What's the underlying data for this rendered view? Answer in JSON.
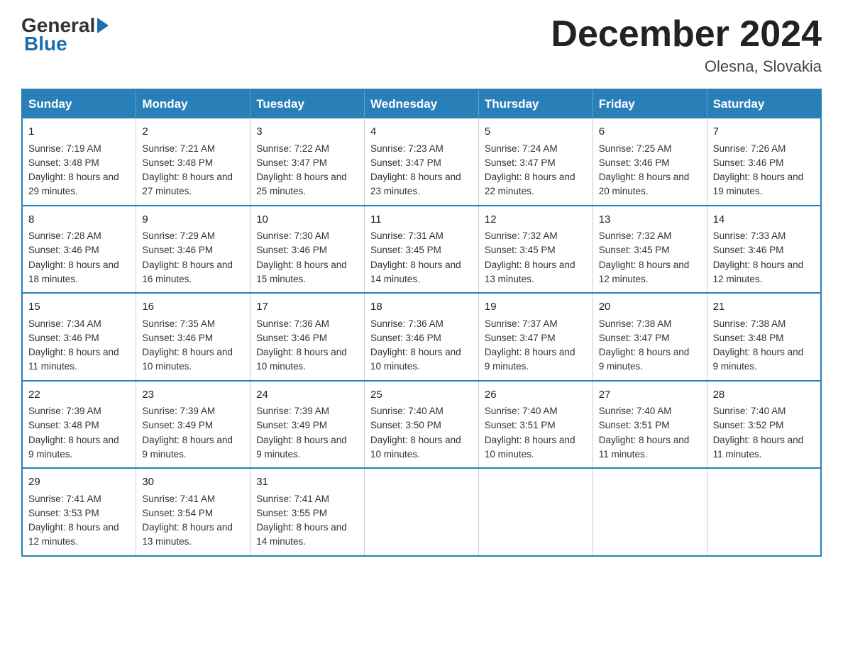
{
  "header": {
    "month_title": "December 2024",
    "location": "Olesna, Slovakia"
  },
  "days_of_week": [
    "Sunday",
    "Monday",
    "Tuesday",
    "Wednesday",
    "Thursday",
    "Friday",
    "Saturday"
  ],
  "weeks": [
    [
      {
        "day": "1",
        "sunrise": "7:19 AM",
        "sunset": "3:48 PM",
        "daylight": "8 hours and 29 minutes."
      },
      {
        "day": "2",
        "sunrise": "7:21 AM",
        "sunset": "3:48 PM",
        "daylight": "8 hours and 27 minutes."
      },
      {
        "day": "3",
        "sunrise": "7:22 AM",
        "sunset": "3:47 PM",
        "daylight": "8 hours and 25 minutes."
      },
      {
        "day": "4",
        "sunrise": "7:23 AM",
        "sunset": "3:47 PM",
        "daylight": "8 hours and 23 minutes."
      },
      {
        "day": "5",
        "sunrise": "7:24 AM",
        "sunset": "3:47 PM",
        "daylight": "8 hours and 22 minutes."
      },
      {
        "day": "6",
        "sunrise": "7:25 AM",
        "sunset": "3:46 PM",
        "daylight": "8 hours and 20 minutes."
      },
      {
        "day": "7",
        "sunrise": "7:26 AM",
        "sunset": "3:46 PM",
        "daylight": "8 hours and 19 minutes."
      }
    ],
    [
      {
        "day": "8",
        "sunrise": "7:28 AM",
        "sunset": "3:46 PM",
        "daylight": "8 hours and 18 minutes."
      },
      {
        "day": "9",
        "sunrise": "7:29 AM",
        "sunset": "3:46 PM",
        "daylight": "8 hours and 16 minutes."
      },
      {
        "day": "10",
        "sunrise": "7:30 AM",
        "sunset": "3:46 PM",
        "daylight": "8 hours and 15 minutes."
      },
      {
        "day": "11",
        "sunrise": "7:31 AM",
        "sunset": "3:45 PM",
        "daylight": "8 hours and 14 minutes."
      },
      {
        "day": "12",
        "sunrise": "7:32 AM",
        "sunset": "3:45 PM",
        "daylight": "8 hours and 13 minutes."
      },
      {
        "day": "13",
        "sunrise": "7:32 AM",
        "sunset": "3:45 PM",
        "daylight": "8 hours and 12 minutes."
      },
      {
        "day": "14",
        "sunrise": "7:33 AM",
        "sunset": "3:46 PM",
        "daylight": "8 hours and 12 minutes."
      }
    ],
    [
      {
        "day": "15",
        "sunrise": "7:34 AM",
        "sunset": "3:46 PM",
        "daylight": "8 hours and 11 minutes."
      },
      {
        "day": "16",
        "sunrise": "7:35 AM",
        "sunset": "3:46 PM",
        "daylight": "8 hours and 10 minutes."
      },
      {
        "day": "17",
        "sunrise": "7:36 AM",
        "sunset": "3:46 PM",
        "daylight": "8 hours and 10 minutes."
      },
      {
        "day": "18",
        "sunrise": "7:36 AM",
        "sunset": "3:46 PM",
        "daylight": "8 hours and 10 minutes."
      },
      {
        "day": "19",
        "sunrise": "7:37 AM",
        "sunset": "3:47 PM",
        "daylight": "8 hours and 9 minutes."
      },
      {
        "day": "20",
        "sunrise": "7:38 AM",
        "sunset": "3:47 PM",
        "daylight": "8 hours and 9 minutes."
      },
      {
        "day": "21",
        "sunrise": "7:38 AM",
        "sunset": "3:48 PM",
        "daylight": "8 hours and 9 minutes."
      }
    ],
    [
      {
        "day": "22",
        "sunrise": "7:39 AM",
        "sunset": "3:48 PM",
        "daylight": "8 hours and 9 minutes."
      },
      {
        "day": "23",
        "sunrise": "7:39 AM",
        "sunset": "3:49 PM",
        "daylight": "8 hours and 9 minutes."
      },
      {
        "day": "24",
        "sunrise": "7:39 AM",
        "sunset": "3:49 PM",
        "daylight": "8 hours and 9 minutes."
      },
      {
        "day": "25",
        "sunrise": "7:40 AM",
        "sunset": "3:50 PM",
        "daylight": "8 hours and 10 minutes."
      },
      {
        "day": "26",
        "sunrise": "7:40 AM",
        "sunset": "3:51 PM",
        "daylight": "8 hours and 10 minutes."
      },
      {
        "day": "27",
        "sunrise": "7:40 AM",
        "sunset": "3:51 PM",
        "daylight": "8 hours and 11 minutes."
      },
      {
        "day": "28",
        "sunrise": "7:40 AM",
        "sunset": "3:52 PM",
        "daylight": "8 hours and 11 minutes."
      }
    ],
    [
      {
        "day": "29",
        "sunrise": "7:41 AM",
        "sunset": "3:53 PM",
        "daylight": "8 hours and 12 minutes."
      },
      {
        "day": "30",
        "sunrise": "7:41 AM",
        "sunset": "3:54 PM",
        "daylight": "8 hours and 13 minutes."
      },
      {
        "day": "31",
        "sunrise": "7:41 AM",
        "sunset": "3:55 PM",
        "daylight": "8 hours and 14 minutes."
      },
      null,
      null,
      null,
      null
    ]
  ]
}
